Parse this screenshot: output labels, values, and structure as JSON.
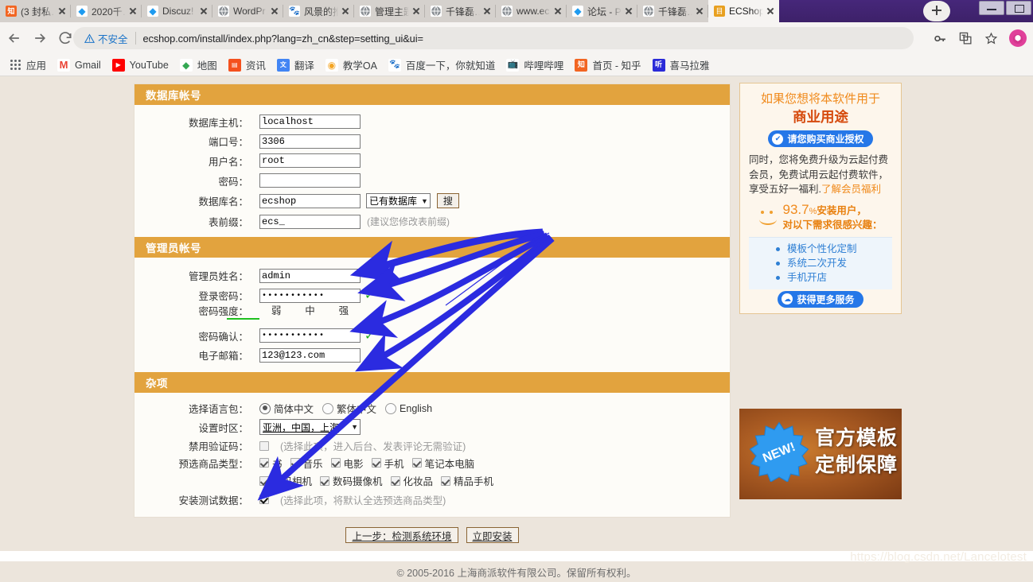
{
  "browser": {
    "tabs": [
      {
        "title": "(3 封私…",
        "favicon": "zhihu-icon",
        "active": false
      },
      {
        "title": "2020千…",
        "favicon": "discuz-icon",
        "active": false
      },
      {
        "title": "Discuz!",
        "favicon": "discuz-icon",
        "active": false
      },
      {
        "title": "WordPr…",
        "favicon": "globe-icon",
        "active": false
      },
      {
        "title": "风景的推…",
        "favicon": "baidu-icon",
        "active": false
      },
      {
        "title": "管理主题…",
        "favicon": "globe-icon",
        "active": false
      },
      {
        "title": "千锋磊…",
        "favicon": "globe-icon",
        "active": false
      },
      {
        "title": "www.ec…",
        "favicon": "globe-icon",
        "active": false
      },
      {
        "title": "论坛 - P…",
        "favicon": "discuz-icon",
        "active": false
      },
      {
        "title": "千锋磊…",
        "favicon": "globe-icon",
        "active": false
      },
      {
        "title": "ECShop…",
        "favicon": "ecshop-icon",
        "active": true
      }
    ],
    "new_tab_label": "+",
    "security_label": "不安全",
    "url": "ecshop.com/install/index.php?lang=zh_cn&step=setting_ui&ui=",
    "bookmarks": [
      {
        "label": "应用",
        "icon": "apps-grid-icon"
      },
      {
        "label": "Gmail",
        "icon": "gmail-icon"
      },
      {
        "label": "YouTube",
        "icon": "youtube-icon"
      },
      {
        "label": "地图",
        "icon": "maps-icon"
      },
      {
        "label": "资讯",
        "icon": "news-icon"
      },
      {
        "label": "翻译",
        "icon": "translate-icon"
      },
      {
        "label": "教学OA",
        "icon": "oa-icon"
      },
      {
        "label": "百度一下，你就知道",
        "icon": "baidu-icon"
      },
      {
        "label": "哔哩哔哩",
        "icon": "bilibili-icon"
      },
      {
        "label": "首页 - 知乎",
        "icon": "zhihu-icon"
      },
      {
        "label": "喜马拉雅",
        "icon": "ximalaya-icon"
      }
    ],
    "toolbar_icons": [
      "key-icon",
      "translate-icon",
      "star-icon",
      "profile-avatar"
    ]
  },
  "form": {
    "db_section": {
      "title": "数据库帐号",
      "fields": [
        {
          "label": "数据库主机：",
          "value": "localhost",
          "name": "db-host-input"
        },
        {
          "label": "端口号：",
          "value": "3306",
          "name": "db-port-input"
        },
        {
          "label": "用户名：",
          "value": "root",
          "name": "db-user-input"
        },
        {
          "label": "密码：",
          "value": "",
          "name": "db-password-input"
        }
      ],
      "dbname": {
        "label": "数据库名：",
        "value": "ecshop",
        "select": "已有数据库",
        "button": "搜"
      },
      "prefix": {
        "label": "表前缀：",
        "value": "ecs_",
        "hint": "(建议您修改表前缀)"
      }
    },
    "admin_section": {
      "title": "管理员帐号",
      "name_row": {
        "label": "管理员姓名：",
        "value": "admin"
      },
      "password_row": {
        "label": "登录密码：",
        "value": "•••••••••••",
        "ok": "✓"
      },
      "strength_row": {
        "label": "密码强度：",
        "levels": [
          "弱",
          "中",
          "强"
        ],
        "level_active": "强"
      },
      "confirm_row": {
        "label": "密码确认：",
        "value": "•••••••••••",
        "ok": "✓"
      },
      "email_row": {
        "label": "电子邮箱：",
        "value": "123@123.com"
      }
    },
    "misc_section": {
      "title": "杂项",
      "language": {
        "label": "选择语言包：",
        "options": [
          {
            "text": "简体中文",
            "selected": true
          },
          {
            "text": "繁体中文",
            "selected": false
          },
          {
            "text": "English",
            "selected": false
          }
        ]
      },
      "timezone": {
        "label": "设置时区：",
        "value": "亚洲，中国，上海"
      },
      "captcha": {
        "label": "禁用验证码：",
        "checked": false,
        "note": "(选择此项，进入后台、发表评论无需验证)"
      },
      "cats": {
        "label": "预选商品类型：",
        "row1": [
          {
            "text": "书",
            "checked": true
          },
          {
            "text": "音乐",
            "checked": true
          },
          {
            "text": "电影",
            "checked": true
          },
          {
            "text": "手机",
            "checked": true
          },
          {
            "text": "笔记本电脑",
            "checked": true
          }
        ],
        "row2": [
          {
            "text": "数码相机",
            "checked": true
          },
          {
            "text": "数码摄像机",
            "checked": true
          },
          {
            "text": "化妆品",
            "checked": true
          },
          {
            "text": "精品手机",
            "checked": true
          }
        ]
      },
      "testdata": {
        "label": "安装测试数据：",
        "checked": true,
        "note": "(选择此项，将默认全选预选商品类型)"
      }
    },
    "buttons": {
      "back": "上一步：检测系统环境",
      "install": "立即安装"
    }
  },
  "promo": {
    "line1": "如果您想将本软件用于",
    "line2": "商业用途",
    "cta": "请您购买商业授权",
    "body_prefix": "同时，您将免费升级为云起付费会员，免费试用云起付费软件，享受五好一福利.",
    "body_link": "了解会员福利",
    "stat_percent": "93.7",
    "stat_percent_sign": "%",
    "stat_suffix": "安装用户，",
    "stat_sub": "对以下需求很感兴趣：",
    "needs": [
      "模板个性化定制",
      "系统二次开发",
      "手机开店"
    ],
    "more_cta": "获得更多服务"
  },
  "banner": {
    "badge": "NEW!",
    "line1": "官方模板",
    "line2": "定制保障"
  },
  "footer": {
    "copyright": "© 2005-2016 上海商派软件有限公司。保留所有权利。"
  },
  "watermark": "https://blog.csdn.net/Lancelotest",
  "colors": {
    "section_header": "#e2a33e",
    "page_bg": "#ece5dc",
    "panel_bg": "#fdfcf8",
    "arrow": "#2b2be0",
    "strength_green": "#1fc01f",
    "promo_orange": "#f08a1c",
    "cta_blue": "#2577e8"
  }
}
